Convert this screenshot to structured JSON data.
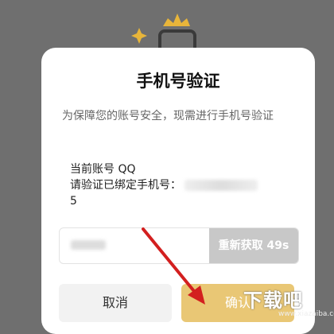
{
  "dialog": {
    "title": "手机号验证",
    "description": "为保障您的账号安全，现需进行手机号验证",
    "account_line": "当前账号 QQ",
    "phone_prompt": "请验证已绑定手机号：",
    "phone_suffix": "5",
    "resend_label": "重新获取 49s",
    "cancel_label": "取消",
    "confirm_label": "确认"
  },
  "watermark": {
    "text": "下载吧",
    "sub": "www.xiazaiba.com"
  },
  "colors": {
    "overlay": "#6f6f6f",
    "confirm": "#e9c775",
    "resend": "#c8c8c8",
    "arrow": "#d31f1f"
  }
}
